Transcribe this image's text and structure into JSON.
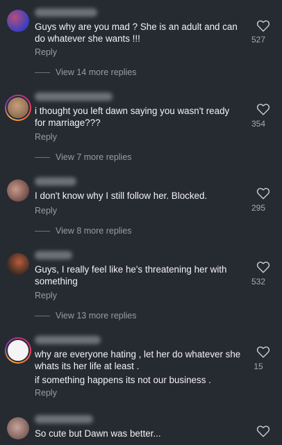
{
  "comments": [
    {
      "lines": [
        "Guys why are you mad ? She is an adult and can",
        "do whatever she wants !!!"
      ],
      "likes": "527",
      "reply": "Reply",
      "view_more": "View 14 more replies",
      "avatar_colors": [
        "#3a3fc2",
        "#b44f7a"
      ],
      "ring": false
    },
    {
      "lines": [
        "i thought you left dawn saying you wasn't ready",
        "for marriage???"
      ],
      "likes": "354",
      "reply": "Reply",
      "view_more": "View 7 more replies",
      "avatar_colors": [
        "#8b6a4f",
        "#c89d7b"
      ],
      "ring": true
    },
    {
      "lines": [
        "I don't know why I still follow her. Blocked."
      ],
      "likes": "295",
      "reply": "Reply",
      "view_more": "View 8 more replies",
      "avatar_colors": [
        "#6e4a45",
        "#c69a8d"
      ],
      "ring": false
    },
    {
      "lines": [
        "Guys, I really feel like he's threatening her with",
        "something"
      ],
      "likes": "532",
      "reply": "Reply",
      "view_more": "View 13 more replies",
      "avatar_colors": [
        "#3a2a22",
        "#b85c3a"
      ],
      "ring": false
    },
    {
      "lines": [
        "why are everyone hating , let her do whatever she",
        "whats its her life at least .",
        "if something happens its not our business ."
      ],
      "likes": "15",
      "reply": "Reply",
      "view_more": "",
      "avatar_colors": [
        "#f2f2f2",
        "#e8e8e8"
      ],
      "ring": true
    },
    {
      "lines": [
        "So cute but Dawn was better..."
      ],
      "likes": "",
      "reply": "",
      "view_more": "",
      "avatar_colors": [
        "#7a5a55",
        "#c4a49b"
      ],
      "ring": false
    }
  ]
}
